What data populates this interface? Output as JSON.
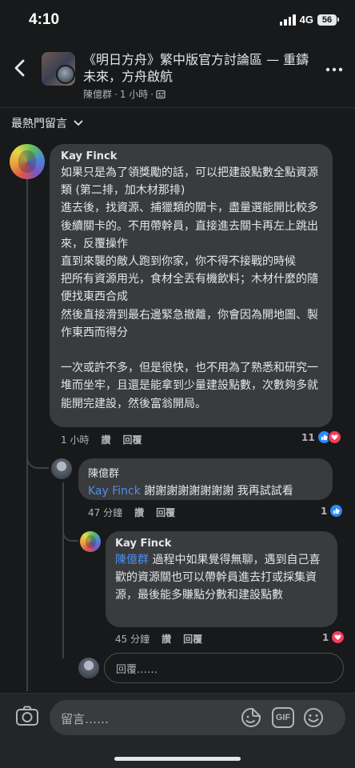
{
  "status": {
    "time": "4:10",
    "network": "4G",
    "battery": "56"
  },
  "header": {
    "title": "《明日方舟》繁中版官方討論區 — 重鑄未來，方舟啟航",
    "author": "陳億群",
    "time": "1 小時",
    "separator": "·"
  },
  "sort": {
    "label": "最熱門留言"
  },
  "comments": [
    {
      "author": "Kay Finck",
      "text": "如果只是為了領獎勵的話，可以把建設點數全點資源類 (第二排，加木材那排)\n進去後，找資源、捕獵類的關卡，盡量選能開比較多後續關卡的。不用帶幹員，直接進去關卡再左上跳出來，反覆操作\n直到來襲的敵人跑到你家，你不得不接戰的時候\n把所有資源用光，食材全丟有機飲料；木材什麼的隨便找東西合成\n然後直接滑到最右邊緊急撤離，你會因為開地圖、製作東西而得分\n\n一次或許不多，但是很快，也不用為了熟悉和研究一堆而坐牢，且還是能拿到少量建設點數，次數夠多就能開完建設，然後富翁開局。",
      "time": "1 小時",
      "like": "讚",
      "reply": "回覆",
      "reactions": "11"
    },
    {
      "author": "陳億群",
      "mention": "Kay Finck",
      "text": " 謝謝謝謝謝謝謝謝 我再試試看",
      "time": "47 分鐘",
      "like": "讚",
      "reply": "回覆",
      "reactions": "1"
    },
    {
      "author": "Kay Finck",
      "mention": "陳億群",
      "text": " 過程中如果覺得無聊，遇到自己喜歡的資源關也可以帶幹員進去打或採集資源，最後能多賺點分數和建設點數",
      "time": "45 分鐘",
      "like": "讚",
      "reply": "回覆",
      "reactions": "1"
    }
  ],
  "reply_input": {
    "placeholder": "回覆……"
  },
  "composer": {
    "placeholder": "留言……",
    "gif_label": "GIF"
  },
  "icons": {
    "back": "chevron-left-icon",
    "more": "more-horizontal-icon",
    "privacy": "group-privacy-icon",
    "sort": "chevron-down-icon",
    "like": "like-reaction-icon",
    "love": "love-reaction-icon",
    "camera": "camera-icon",
    "sticker": "sticker-icon",
    "gif": "gif-icon",
    "emoji": "emoji-icon"
  },
  "colors": {
    "background": "#18191a",
    "bubble": "#3a3b3c",
    "mention": "#4c8ff5",
    "like": "#2d88ff",
    "love": "#f33e58"
  }
}
